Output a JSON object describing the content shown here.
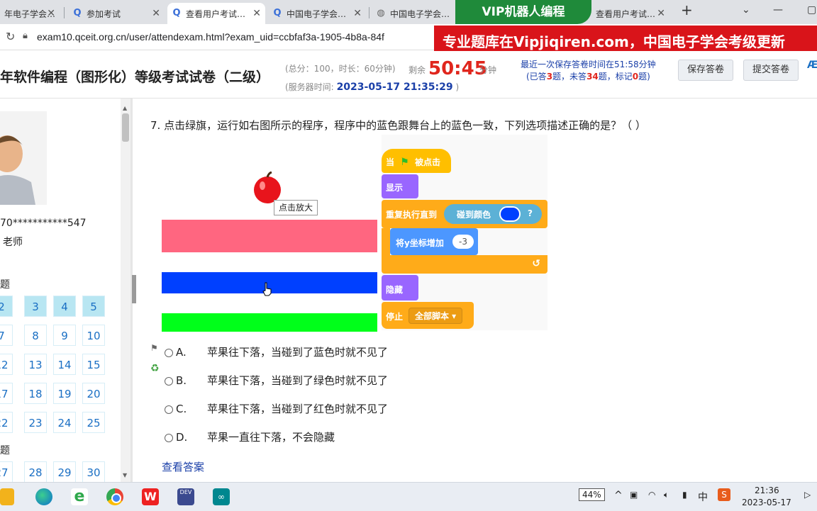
{
  "browser": {
    "tabs": [
      {
        "label": "年电子学会…",
        "icon": "Q"
      },
      {
        "label": "参加考试",
        "icon": "Q"
      },
      {
        "label": "查看用户考试…",
        "icon": "Q"
      },
      {
        "label": "中国电子学会…",
        "icon": "Q"
      },
      {
        "label": "中国电子学会…",
        "icon": "globe"
      },
      {
        "label": "查看用户考试…",
        "icon": "Q"
      }
    ],
    "new_tab": "+",
    "url": "exam10.qceit.org.cn/user/attendexam.html?exam_uid=ccbfaf3a-1905-4b8a-84f"
  },
  "overlay": {
    "top": "VIP机器人编程",
    "banner": "专业题库在Vipjiqiren.com，中国电子学会考级更新"
  },
  "exam": {
    "title": "年软件编程（图形化）等级考试试卷（二级）",
    "meta1": "(总分：100，时长：60分钟)",
    "server_label": "(服务器时间:",
    "server_time": "2023-05-17 21:35:29",
    "server_close": ")",
    "remain_label": "剩余",
    "countdown": "50:45",
    "min_unit": "分钟",
    "save_note": "最近一次保存答卷时间在51:58分钟",
    "answered_prefix": "(已答",
    "answered": "3",
    "unanswered_prefix": "题，未答",
    "unanswered": "34",
    "marked_prefix": "题，标记",
    "marked": "0",
    "marked_suffix": "题)",
    "save_button": "保存答卷",
    "submit_button": "提交答卷"
  },
  "candidate": {
    "id": "70***********547",
    "teacher": "老师",
    "section1": "题",
    "section2": "题"
  },
  "question_numbers": [
    {
      "n": "2",
      "answered": true
    },
    {
      "n": "3",
      "answered": true
    },
    {
      "n": "4",
      "answered": true
    },
    {
      "n": "5",
      "answered": true
    },
    {
      "n": "7",
      "answered": false
    },
    {
      "n": "8",
      "answered": false
    },
    {
      "n": "9",
      "answered": false
    },
    {
      "n": "10",
      "answered": false
    },
    {
      "n": "12",
      "answered": false
    },
    {
      "n": "13",
      "answered": false
    },
    {
      "n": "14",
      "answered": false
    },
    {
      "n": "15",
      "answered": false
    },
    {
      "n": "17",
      "answered": false
    },
    {
      "n": "18",
      "answered": false
    },
    {
      "n": "19",
      "answered": false
    },
    {
      "n": "20",
      "answered": false
    },
    {
      "n": "22",
      "answered": false
    },
    {
      "n": "23",
      "answered": false
    },
    {
      "n": "24",
      "answered": false
    },
    {
      "n": "25",
      "answered": false
    },
    {
      "n": "27",
      "answered": false
    },
    {
      "n": "28",
      "answered": false
    },
    {
      "n": "29",
      "answered": false
    },
    {
      "n": "30",
      "answered": false
    }
  ],
  "question": {
    "text": "7. 点击绿旗，运行如右图所示的程序，程序中的蓝色跟舞台上的蓝色一致，下列选项描述正确的是？（    ）",
    "tooltip": "点击放大",
    "colors": {
      "pink": "#ff6680",
      "blue": "#0040ff",
      "green": "#00ff1a"
    },
    "options": [
      {
        "letter": "A.",
        "text": "苹果往下落，当碰到了蓝色时就不见了"
      },
      {
        "letter": "B.",
        "text": "苹果往下落，当碰到了绿色时就不见了"
      },
      {
        "letter": "C.",
        "text": "苹果往下落，当碰到了红色时就不见了"
      },
      {
        "letter": "D.",
        "text": "苹果一直往下落，不会隐藏"
      }
    ],
    "view_answer": "查看答案"
  },
  "code_blocks": {
    "when": "当",
    "clicked": "被点击",
    "show": "显示",
    "repeat_until": "重复执行直到",
    "touch_color": "碰到颜色",
    "q": "?",
    "change_y": "将y坐标增加",
    "change_val": "-3",
    "hide": "隐藏",
    "stop": "停止",
    "all_scripts": "全部脚本 ▾"
  },
  "taskbar": {
    "battery": "44%",
    "ime": "中",
    "time": "21:36",
    "date": "2023-05-17"
  }
}
